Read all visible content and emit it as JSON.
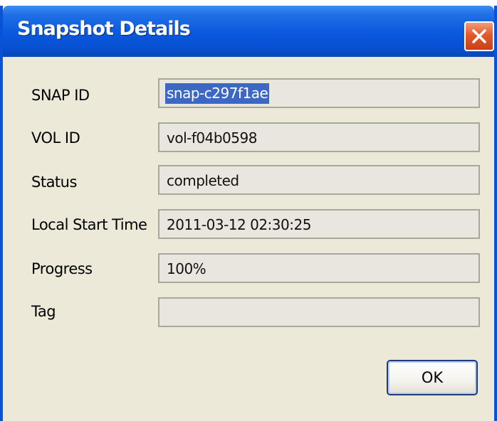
{
  "window": {
    "title": "Snapshot Details",
    "close_icon": "close-icon"
  },
  "fields": [
    {
      "label": "SNAP ID",
      "value": "snap-c297f1ae",
      "selected": true
    },
    {
      "label": "VOL ID",
      "value": "vol-f04b0598"
    },
    {
      "label": "Status",
      "value": "completed"
    },
    {
      "label": "Local Start Time",
      "value": "2011-03-12 02:30:25"
    },
    {
      "label": "Progress",
      "value": "100%"
    },
    {
      "label": "Tag",
      "value": ""
    }
  ],
  "buttons": {
    "ok_label": "OK"
  },
  "colors": {
    "titlebar": "#0a58dc",
    "dialog_bg": "#ece9d8",
    "selection": "#3d67c4",
    "close_button": "#e25a2b"
  }
}
